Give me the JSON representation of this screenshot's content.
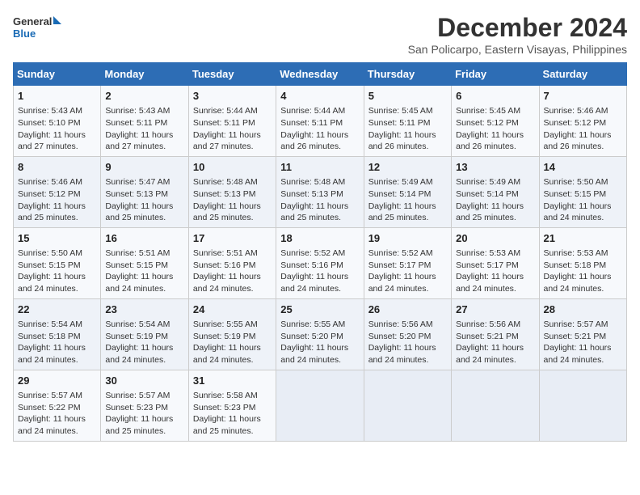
{
  "header": {
    "logo_line1": "General",
    "logo_line2": "Blue",
    "month_year": "December 2024",
    "location": "San Policarpo, Eastern Visayas, Philippines"
  },
  "days_of_week": [
    "Sunday",
    "Monday",
    "Tuesday",
    "Wednesday",
    "Thursday",
    "Friday",
    "Saturday"
  ],
  "weeks": [
    [
      {
        "day": 1,
        "info": "Sunrise: 5:43 AM\nSunset: 5:10 PM\nDaylight: 11 hours\nand 27 minutes."
      },
      {
        "day": 2,
        "info": "Sunrise: 5:43 AM\nSunset: 5:11 PM\nDaylight: 11 hours\nand 27 minutes."
      },
      {
        "day": 3,
        "info": "Sunrise: 5:44 AM\nSunset: 5:11 PM\nDaylight: 11 hours\nand 27 minutes."
      },
      {
        "day": 4,
        "info": "Sunrise: 5:44 AM\nSunset: 5:11 PM\nDaylight: 11 hours\nand 26 minutes."
      },
      {
        "day": 5,
        "info": "Sunrise: 5:45 AM\nSunset: 5:11 PM\nDaylight: 11 hours\nand 26 minutes."
      },
      {
        "day": 6,
        "info": "Sunrise: 5:45 AM\nSunset: 5:12 PM\nDaylight: 11 hours\nand 26 minutes."
      },
      {
        "day": 7,
        "info": "Sunrise: 5:46 AM\nSunset: 5:12 PM\nDaylight: 11 hours\nand 26 minutes."
      }
    ],
    [
      {
        "day": 8,
        "info": "Sunrise: 5:46 AM\nSunset: 5:12 PM\nDaylight: 11 hours\nand 25 minutes."
      },
      {
        "day": 9,
        "info": "Sunrise: 5:47 AM\nSunset: 5:13 PM\nDaylight: 11 hours\nand 25 minutes."
      },
      {
        "day": 10,
        "info": "Sunrise: 5:48 AM\nSunset: 5:13 PM\nDaylight: 11 hours\nand 25 minutes."
      },
      {
        "day": 11,
        "info": "Sunrise: 5:48 AM\nSunset: 5:13 PM\nDaylight: 11 hours\nand 25 minutes."
      },
      {
        "day": 12,
        "info": "Sunrise: 5:49 AM\nSunset: 5:14 PM\nDaylight: 11 hours\nand 25 minutes."
      },
      {
        "day": 13,
        "info": "Sunrise: 5:49 AM\nSunset: 5:14 PM\nDaylight: 11 hours\nand 25 minutes."
      },
      {
        "day": 14,
        "info": "Sunrise: 5:50 AM\nSunset: 5:15 PM\nDaylight: 11 hours\nand 24 minutes."
      }
    ],
    [
      {
        "day": 15,
        "info": "Sunrise: 5:50 AM\nSunset: 5:15 PM\nDaylight: 11 hours\nand 24 minutes."
      },
      {
        "day": 16,
        "info": "Sunrise: 5:51 AM\nSunset: 5:15 PM\nDaylight: 11 hours\nand 24 minutes."
      },
      {
        "day": 17,
        "info": "Sunrise: 5:51 AM\nSunset: 5:16 PM\nDaylight: 11 hours\nand 24 minutes."
      },
      {
        "day": 18,
        "info": "Sunrise: 5:52 AM\nSunset: 5:16 PM\nDaylight: 11 hours\nand 24 minutes."
      },
      {
        "day": 19,
        "info": "Sunrise: 5:52 AM\nSunset: 5:17 PM\nDaylight: 11 hours\nand 24 minutes."
      },
      {
        "day": 20,
        "info": "Sunrise: 5:53 AM\nSunset: 5:17 PM\nDaylight: 11 hours\nand 24 minutes."
      },
      {
        "day": 21,
        "info": "Sunrise: 5:53 AM\nSunset: 5:18 PM\nDaylight: 11 hours\nand 24 minutes."
      }
    ],
    [
      {
        "day": 22,
        "info": "Sunrise: 5:54 AM\nSunset: 5:18 PM\nDaylight: 11 hours\nand 24 minutes."
      },
      {
        "day": 23,
        "info": "Sunrise: 5:54 AM\nSunset: 5:19 PM\nDaylight: 11 hours\nand 24 minutes."
      },
      {
        "day": 24,
        "info": "Sunrise: 5:55 AM\nSunset: 5:19 PM\nDaylight: 11 hours\nand 24 minutes."
      },
      {
        "day": 25,
        "info": "Sunrise: 5:55 AM\nSunset: 5:20 PM\nDaylight: 11 hours\nand 24 minutes."
      },
      {
        "day": 26,
        "info": "Sunrise: 5:56 AM\nSunset: 5:20 PM\nDaylight: 11 hours\nand 24 minutes."
      },
      {
        "day": 27,
        "info": "Sunrise: 5:56 AM\nSunset: 5:21 PM\nDaylight: 11 hours\nand 24 minutes."
      },
      {
        "day": 28,
        "info": "Sunrise: 5:57 AM\nSunset: 5:21 PM\nDaylight: 11 hours\nand 24 minutes."
      }
    ],
    [
      {
        "day": 29,
        "info": "Sunrise: 5:57 AM\nSunset: 5:22 PM\nDaylight: 11 hours\nand 24 minutes."
      },
      {
        "day": 30,
        "info": "Sunrise: 5:57 AM\nSunset: 5:23 PM\nDaylight: 11 hours\nand 25 minutes."
      },
      {
        "day": 31,
        "info": "Sunrise: 5:58 AM\nSunset: 5:23 PM\nDaylight: 11 hours\nand 25 minutes."
      },
      null,
      null,
      null,
      null
    ]
  ]
}
